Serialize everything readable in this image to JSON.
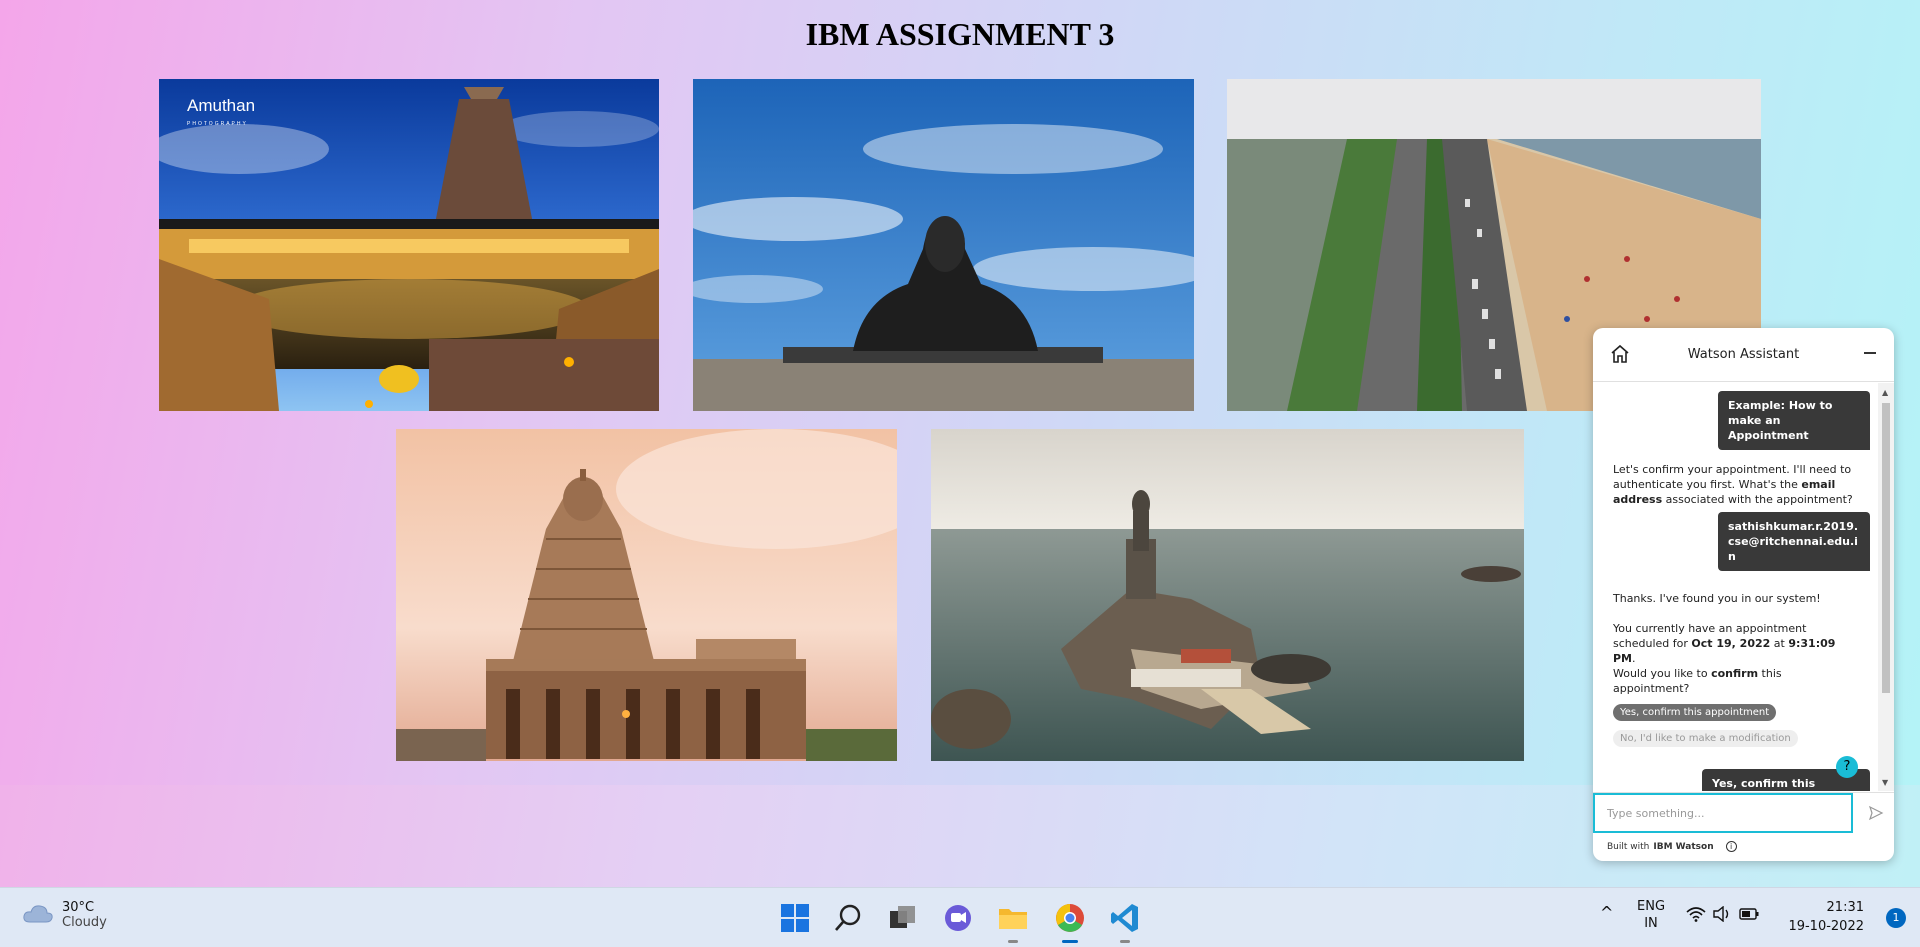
{
  "page": {
    "title": "IBM ASSIGNMENT 3"
  },
  "photos": [
    {
      "name": "temple-pond-photo",
      "watermark": "Amuthan",
      "watermark_sub": "PHOTOGRAPHY"
    },
    {
      "name": "adiyogi-statue-photo"
    },
    {
      "name": "marina-beach-photo"
    },
    {
      "name": "brihadeeswara-temple-photo"
    },
    {
      "name": "thiruvalluvar-statue-photo"
    }
  ],
  "watson": {
    "title": "Watson Assistant",
    "messages": {
      "user1": "Example: How to make an Appointment",
      "bot1_a": "Let's confirm your appointment. I'll need to authenticate you first. What's the ",
      "bot1_b": "email address",
      "bot1_c": " associated with the appointment?",
      "user2": "sathishkumar.r.2019.cse@ritchennai.edu.in",
      "bot2": "Thanks. I've found you in our system!",
      "bot3_a": "You currently have an appointment scheduled for ",
      "bot3_b": "Oct 19, 2022",
      "bot3_c": " at ",
      "bot3_d": "9:31:09 PM",
      "bot3_e": ".",
      "bot4_a": "Would you like to ",
      "bot4_b": "confirm",
      "bot4_c": " this appointment?",
      "chip1": "Yes, confirm this appointment",
      "chip2": "No, I'd like to make a modification",
      "user3": "Yes, confirm this appointment"
    },
    "input_placeholder": "Type something...",
    "footer_a": "Built with",
    "footer_b": "IBM Watson",
    "help": "?"
  },
  "taskbar": {
    "weather_temp": "30°C",
    "weather_desc": "Cloudy",
    "lang_1": "ENG",
    "lang_2": "IN",
    "time": "21:31",
    "date": "19-10-2022",
    "notifications": "1",
    "tray_arrow": "^"
  },
  "colors": {
    "accent": "#1abcd6",
    "bubble": "#393939",
    "taskbar": "#dfe8f5"
  }
}
